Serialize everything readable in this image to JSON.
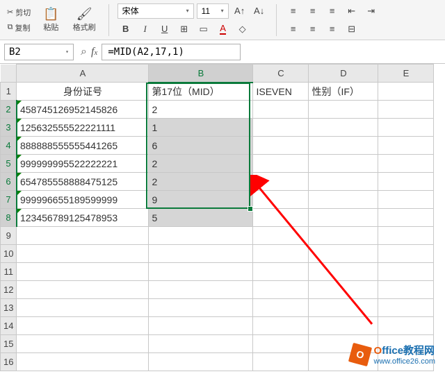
{
  "ribbon": {
    "cut": "剪切",
    "copy": "复制",
    "paste": "粘贴",
    "format_painter": "格式刷",
    "font_name": "宋体",
    "font_size": "11"
  },
  "namebox": "B2",
  "formula": "=MID(A2,17,1)",
  "columns": [
    "A",
    "B",
    "C",
    "D",
    "E"
  ],
  "row_numbers": [
    1,
    2,
    3,
    4,
    5,
    6,
    7,
    8,
    9,
    10,
    11,
    12,
    13,
    14,
    15,
    16
  ],
  "headers": {
    "A": "身份证号",
    "B": "第17位（MID）",
    "C": "ISEVEN",
    "D": "性别（IF）"
  },
  "rows": [
    {
      "A": "458745126952145826",
      "B": "2"
    },
    {
      "A": "125632555522221111",
      "B": "1"
    },
    {
      "A": "888888555555441265",
      "B": "6"
    },
    {
      "A": "999999995522222221",
      "B": "2"
    },
    {
      "A": "654785558888475125",
      "B": "2"
    },
    {
      "A": "999996655189599999",
      "B": "9"
    },
    {
      "A": "123456789125478953",
      "B": "5"
    }
  ],
  "watermark": {
    "title_o": "O",
    "title_rest": "ffice教程网",
    "url": "www.office26.com"
  }
}
